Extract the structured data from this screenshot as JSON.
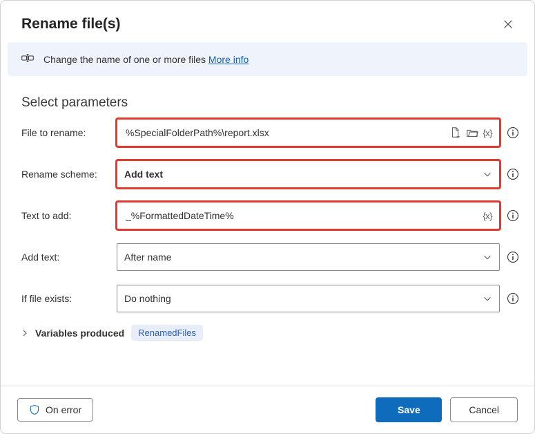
{
  "header": {
    "title": "Rename file(s)"
  },
  "banner": {
    "text": "Change the name of one or more files ",
    "link": "More info"
  },
  "section": {
    "title": "Select parameters"
  },
  "fields": {
    "fileToRename": {
      "label": "File to rename:",
      "value": "%SpecialFolderPath%\\report.xlsx"
    },
    "renameScheme": {
      "label": "Rename scheme:",
      "value": "Add text"
    },
    "textToAdd": {
      "label": "Text to add:",
      "value": "_%FormattedDateTime%"
    },
    "addText": {
      "label": "Add text:",
      "value": "After name"
    },
    "ifFileExists": {
      "label": "If file exists:",
      "value": "Do nothing"
    }
  },
  "variablesProduced": {
    "label": "Variables produced",
    "chip": "RenamedFiles"
  },
  "footer": {
    "onError": "On error",
    "save": "Save",
    "cancel": "Cancel"
  }
}
